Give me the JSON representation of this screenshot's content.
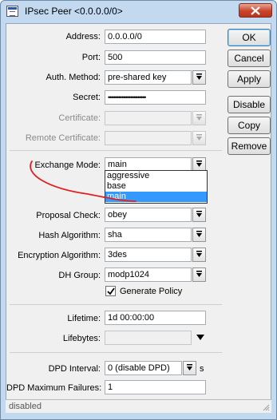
{
  "window": {
    "title": "IPsec Peer <0.0.0.0/0>"
  },
  "form": {
    "address": {
      "label": "Address:",
      "value": "0.0.0.0/0"
    },
    "port": {
      "label": "Port:",
      "value": "500"
    },
    "auth_method": {
      "label": "Auth. Method:",
      "value": "pre-shared key"
    },
    "secret": {
      "label": "Secret:",
      "value": "••••••••••••••••••••••"
    },
    "certificate": {
      "label": "Certificate:",
      "value": ""
    },
    "remote_certificate": {
      "label": "Remote Certificate:",
      "value": ""
    },
    "exchange_mode": {
      "label": "Exchange Mode:",
      "value": "main",
      "options": [
        "aggressive",
        "base",
        "main"
      ],
      "selected_option": "main"
    },
    "proposal_check": {
      "label": "Proposal Check:",
      "value": "obey"
    },
    "hash_algorithm": {
      "label": "Hash Algorithm:",
      "value": "sha"
    },
    "encryption_algorithm": {
      "label": "Encryption Algorithm:",
      "value": "3des"
    },
    "dh_group": {
      "label": "DH Group:",
      "value": "modp1024"
    },
    "generate_policy": {
      "label": "Generate Policy",
      "checked": true
    },
    "lifetime": {
      "label": "Lifetime:",
      "value": "1d 00:00:00"
    },
    "lifebytes": {
      "label": "Lifebytes:",
      "value": ""
    },
    "dpd_interval": {
      "label": "DPD Interval:",
      "value": "0 (disable DPD)",
      "unit": "s"
    },
    "dpd_max_failures": {
      "label": "DPD Maximum Failures:",
      "value": "1"
    }
  },
  "buttons": {
    "ok": "OK",
    "cancel": "Cancel",
    "apply": "Apply",
    "disable": "Disable",
    "copy": "Copy",
    "remove": "Remove"
  },
  "status": {
    "text": "disabled"
  },
  "colors": {
    "selection": "#3399ff",
    "annotation": "#e02020",
    "close_button": "#c9432a"
  }
}
